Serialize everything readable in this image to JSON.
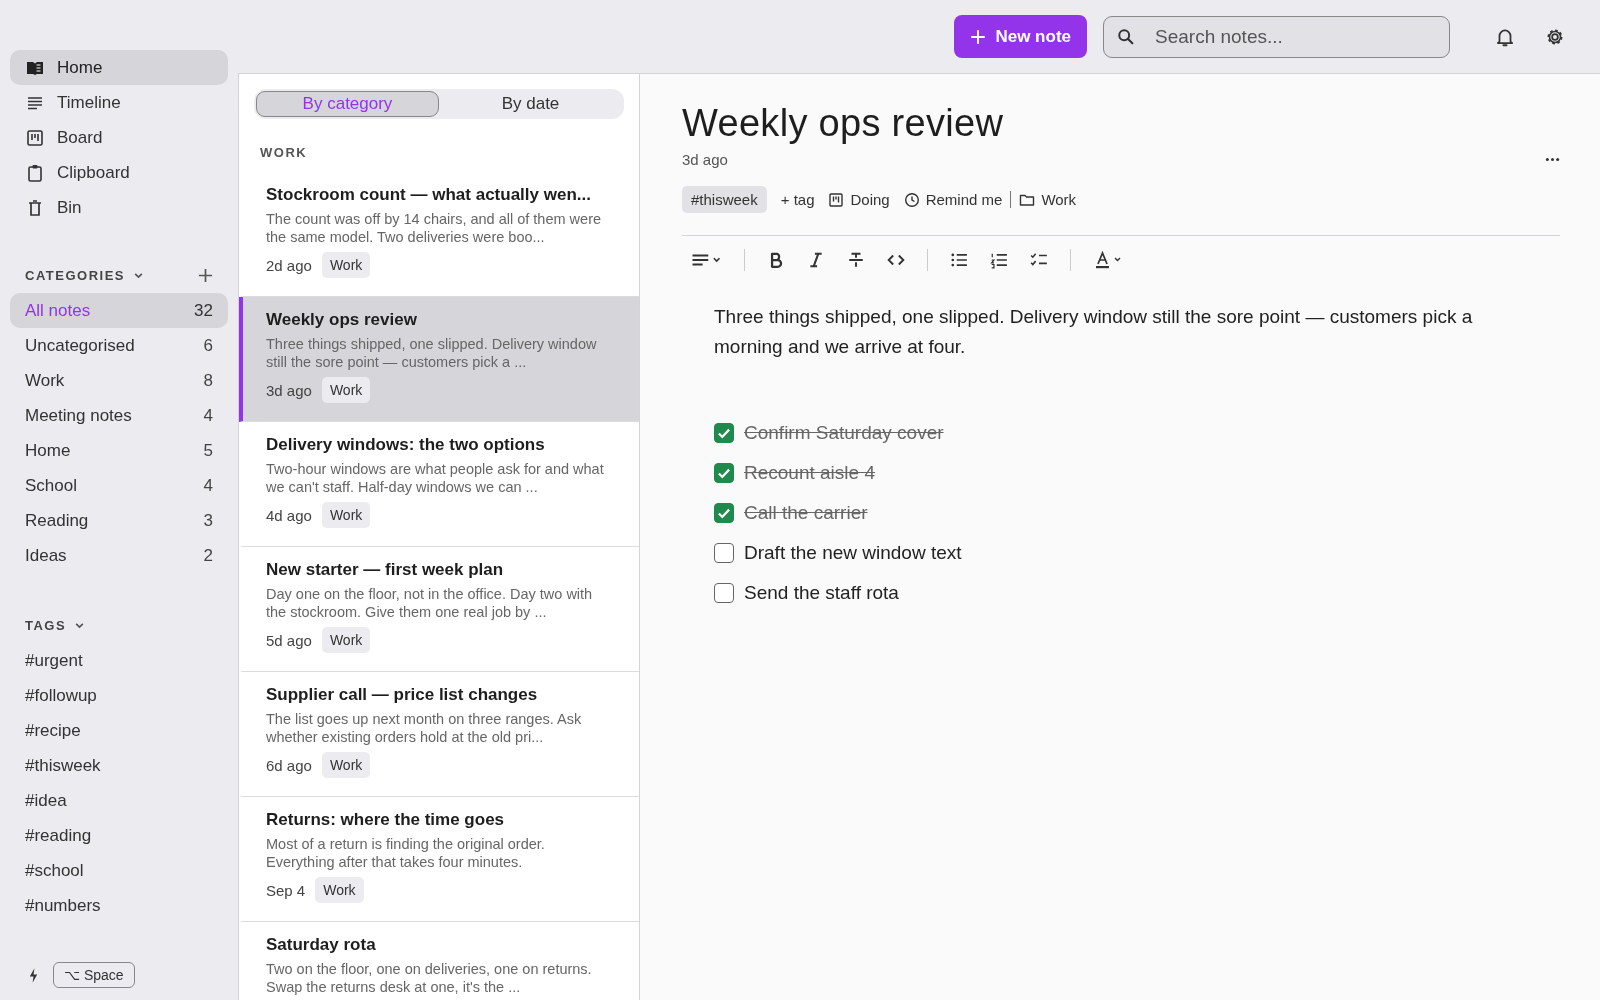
{
  "topbar": {
    "new_note": "New note",
    "search": {
      "placeholder": "Search notes..."
    }
  },
  "nav": [
    {
      "kind": "book",
      "label": "Home",
      "selected": true
    },
    {
      "kind": "lines",
      "label": "Timeline",
      "selected": false
    },
    {
      "kind": "board",
      "label": "Board",
      "selected": false
    },
    {
      "kind": "clipboard",
      "label": "Clipboard",
      "selected": false
    },
    {
      "kind": "bin",
      "label": "Bin",
      "selected": false
    }
  ],
  "categories": {
    "heading": "CATEGORIES",
    "items": [
      {
        "label": "All notes",
        "count": "32",
        "selected": true
      },
      {
        "label": "Uncategorised",
        "count": "6",
        "selected": false
      },
      {
        "label": "Work",
        "count": "8",
        "selected": false
      },
      {
        "label": "Meeting notes",
        "count": "4",
        "selected": false
      },
      {
        "label": "Home",
        "count": "5",
        "selected": false
      },
      {
        "label": "School",
        "count": "4",
        "selected": false
      },
      {
        "label": "Reading",
        "count": "3",
        "selected": false
      },
      {
        "label": "Ideas",
        "count": "2",
        "selected": false
      }
    ]
  },
  "tags": {
    "heading": "TAGS",
    "items": [
      "#urgent",
      "#followup",
      "#recipe",
      "#thisweek",
      "#idea",
      "#reading",
      "#school",
      "#numbers"
    ]
  },
  "shortcut": {
    "key": "⌥ Space"
  },
  "list": {
    "tabs": [
      {
        "label": "By category",
        "selected": true
      },
      {
        "label": "By date",
        "selected": false
      }
    ],
    "group": "WORK",
    "notes": [
      {
        "title": "Stockroom count — what actually wen...",
        "preview": "The count was off by 14 chairs, and all of them were the same model. Two deliveries were boo...",
        "date": "2d ago",
        "tag": "Work",
        "selected": false
      },
      {
        "title": "Weekly ops review",
        "preview": "Three things shipped, one slipped. Delivery window still the sore point — customers pick a ...",
        "date": "3d ago",
        "tag": "Work",
        "selected": true
      },
      {
        "title": "Delivery windows: the two options",
        "preview": "Two-hour windows are what people ask for and what we can't staff. Half-day windows we can ...",
        "date": "4d ago",
        "tag": "Work",
        "selected": false
      },
      {
        "title": "New starter — first week plan",
        "preview": "Day one on the floor, not in the office. Day two with the stockroom. Give them one real job by ...",
        "date": "5d ago",
        "tag": "Work",
        "selected": false
      },
      {
        "title": "Supplier call — price list changes",
        "preview": "The list goes up next month on three ranges. Ask whether existing orders hold at the old pri...",
        "date": "6d ago",
        "tag": "Work",
        "selected": false
      },
      {
        "title": "Returns: where the time goes",
        "preview": "Most of a return is finding the original order. Everything after that takes four minutes.",
        "date": "Sep 4",
        "tag": "Work",
        "selected": false
      },
      {
        "title": "Saturday rota",
        "preview": "Two on the floor, one on deliveries, one on returns. Swap the returns desk at one, it's the ...",
        "selected": false
      }
    ]
  },
  "editor": {
    "title": "Weekly ops review",
    "date": "3d ago",
    "meta": [
      {
        "kind": "tag",
        "label": "#thisweek"
      },
      {
        "kind": "add",
        "label": "+ tag"
      },
      {
        "kind": "board",
        "label": "Doing"
      },
      {
        "kind": "clock",
        "label": "Remind me"
      },
      {
        "kind": "folder",
        "label": "Work"
      }
    ],
    "body": "Three things shipped, one slipped. Delivery window still the sore point — customers pick a morning and we arrive at four.",
    "checklist": [
      {
        "text": "Confirm Saturday cover",
        "checked": true
      },
      {
        "text": "Recount aisle 4",
        "checked": true
      },
      {
        "text": "Call the carrier",
        "checked": true
      },
      {
        "text": "Draft the new window text",
        "checked": false
      },
      {
        "text": "Send the staff rota",
        "checked": false
      }
    ]
  }
}
